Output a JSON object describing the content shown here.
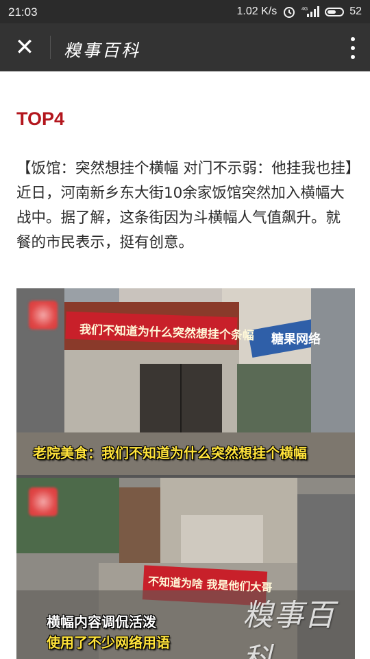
{
  "status_bar": {
    "time": "21:03",
    "speed": "1.02 K/s",
    "battery": "52",
    "icons": [
      "alarm-icon",
      "signal-4g-icon",
      "battery-icon"
    ]
  },
  "nav": {
    "close_icon": "✕",
    "title": "糗事百科",
    "more_icon": "more-vertical-icon"
  },
  "article": {
    "heading": "TOP4",
    "paragraph": "【饭馆：突然想挂个横幅 对门不示弱：他挂我也挂】近日，河南新乡东大街10余家饭馆突然加入横幅大战中。据了解，这条街因为斗横幅人气值飙升。就餐的市民表示，挺有创意。",
    "photo": {
      "banner_top": "我们不知道为什么突然想挂个条幅",
      "shop_sign": "糖果网络",
      "caption_top": "老院美食：我们不知道为什么突然想挂个横幅",
      "banner_bottom": "不知道为啥 我是他们大哥",
      "caption_bottom_line1": "横幅内容调侃活泼",
      "caption_bottom_line2": "使用了不少网络用语",
      "watermark": "糗事百科"
    }
  },
  "colors": {
    "status_bar_bg": "#2b2b2b",
    "nav_bg": "#333333",
    "heading": "#b3161d",
    "caption_yellow": "#ffe33b",
    "banner_red": "#c8202a"
  }
}
